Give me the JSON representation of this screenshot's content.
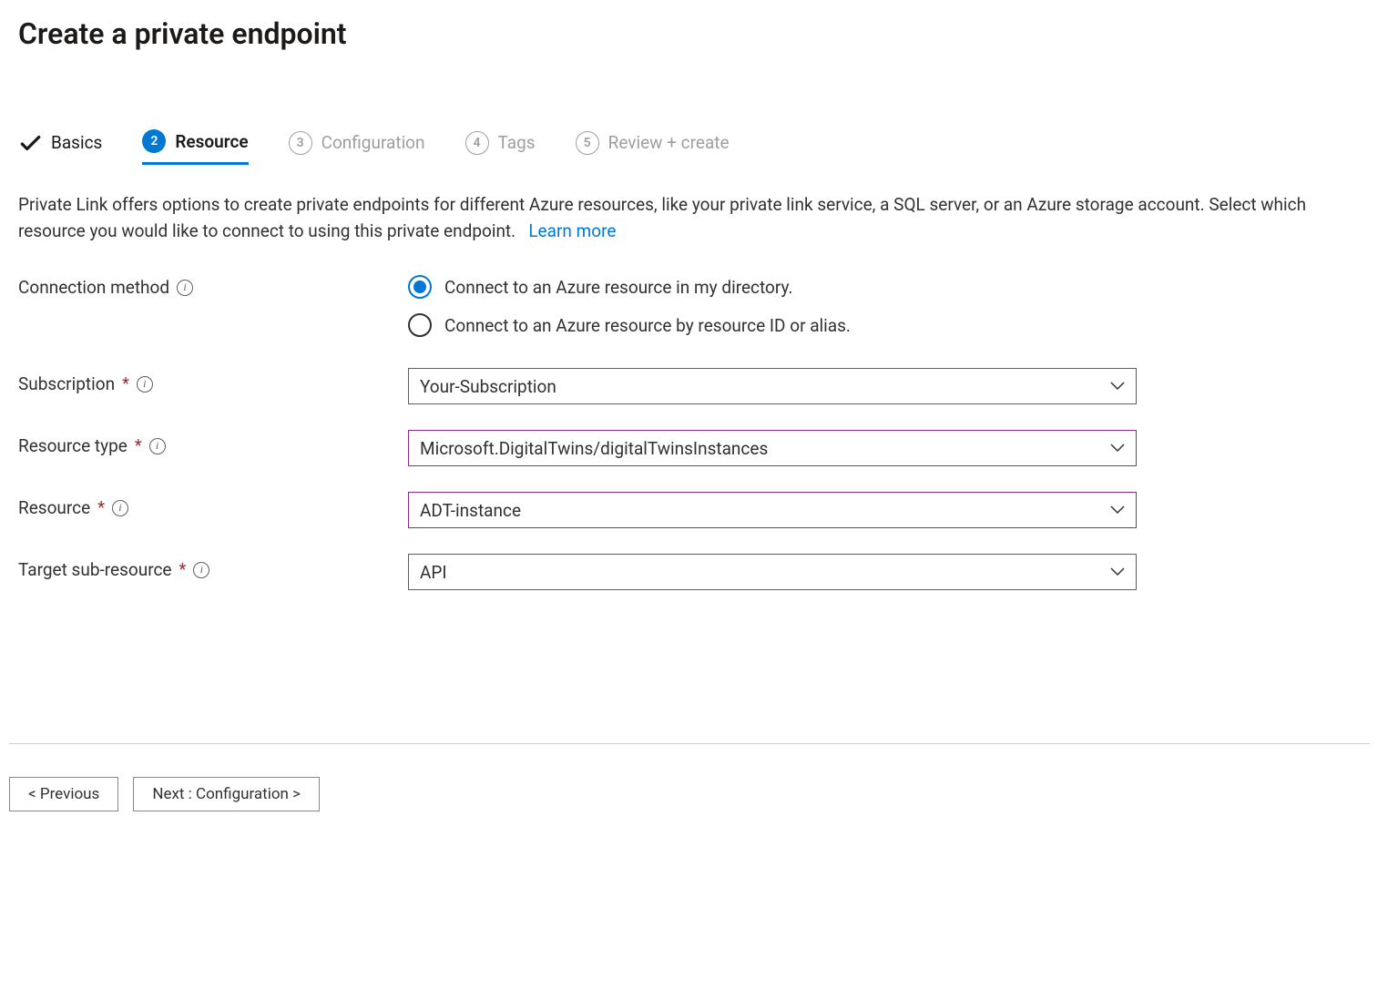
{
  "page": {
    "title": "Create a private endpoint"
  },
  "tabs": [
    {
      "number": "",
      "label": "Basics",
      "state": "completed"
    },
    {
      "number": "2",
      "label": "Resource",
      "state": "active"
    },
    {
      "number": "3",
      "label": "Configuration",
      "state": "inactive"
    },
    {
      "number": "4",
      "label": "Tags",
      "state": "inactive"
    },
    {
      "number": "5",
      "label": "Review + create",
      "state": "inactive"
    }
  ],
  "description": {
    "text": "Private Link offers options to create private endpoints for different Azure resources, like your private link service, a SQL server, or an Azure storage account. Select which resource you would like to connect to using this private endpoint.",
    "learn_more": "Learn more"
  },
  "form": {
    "connection_method": {
      "label": "Connection method",
      "options": [
        {
          "label": "Connect to an Azure resource in my directory.",
          "selected": true
        },
        {
          "label": "Connect to an Azure resource by resource ID or alias.",
          "selected": false
        }
      ]
    },
    "subscription": {
      "label": "Subscription",
      "value": "Your-Subscription",
      "required": true
    },
    "resource_type": {
      "label": "Resource type",
      "value": "Microsoft.DigitalTwins/digitalTwinsInstances",
      "required": true
    },
    "resource": {
      "label": "Resource",
      "value": "ADT-instance",
      "required": true
    },
    "target_sub_resource": {
      "label": "Target sub-resource",
      "value": "API",
      "required": true
    }
  },
  "footer": {
    "previous": "< Previous",
    "next": "Next : Configuration >"
  }
}
